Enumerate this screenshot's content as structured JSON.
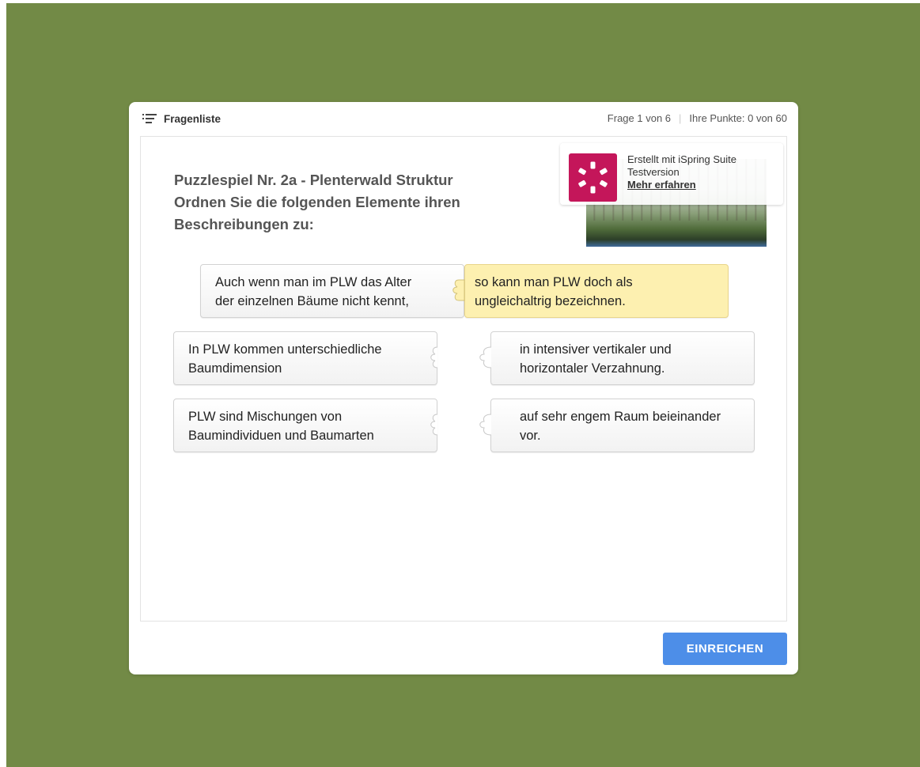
{
  "header": {
    "question_list_label": "Fragenliste",
    "progress": "Frage 1 von 6",
    "score": "Ihre Punkte: 0 von 60"
  },
  "question": {
    "title_line1": "Puzzlespiel Nr. 2a - Plenterwald Struktur",
    "title_line2": "Ordnen Sie die folgenden Elemente ihren",
    "title_line3": "Beschreibungen zu:"
  },
  "watermark": {
    "line1": "Erstellt mit iSpring Suite",
    "line2": "Testversion",
    "link": "Mehr erfahren"
  },
  "pairs": [
    {
      "left_line1": "Auch wenn man im PLW das Alter",
      "left_line2": "der einzelnen Bäume nicht kennt,",
      "right_line1": "so kann man PLW doch als",
      "right_line2": "ungleichaltrig bezeichnen.",
      "matched": true
    },
    {
      "left_line1": "In PLW kommen unterschiedliche",
      "left_line2": "Baumdimension",
      "right_line1": "in intensiver vertikaler und",
      "right_line2": "horizontaler Verzahnung.",
      "matched": false
    },
    {
      "left_line1": "PLW sind Mischungen von",
      "left_line2": "Baumindividuen und Baumarten",
      "right_line1": "auf sehr engem Raum beieinander",
      "right_line2": "vor.",
      "matched": false
    }
  ],
  "submit_label": "EINREICHEN",
  "colors": {
    "background": "#728a46",
    "matched_piece": "#fdf0b0",
    "submit_button": "#4d8ee8",
    "logo": "#c4165a"
  }
}
